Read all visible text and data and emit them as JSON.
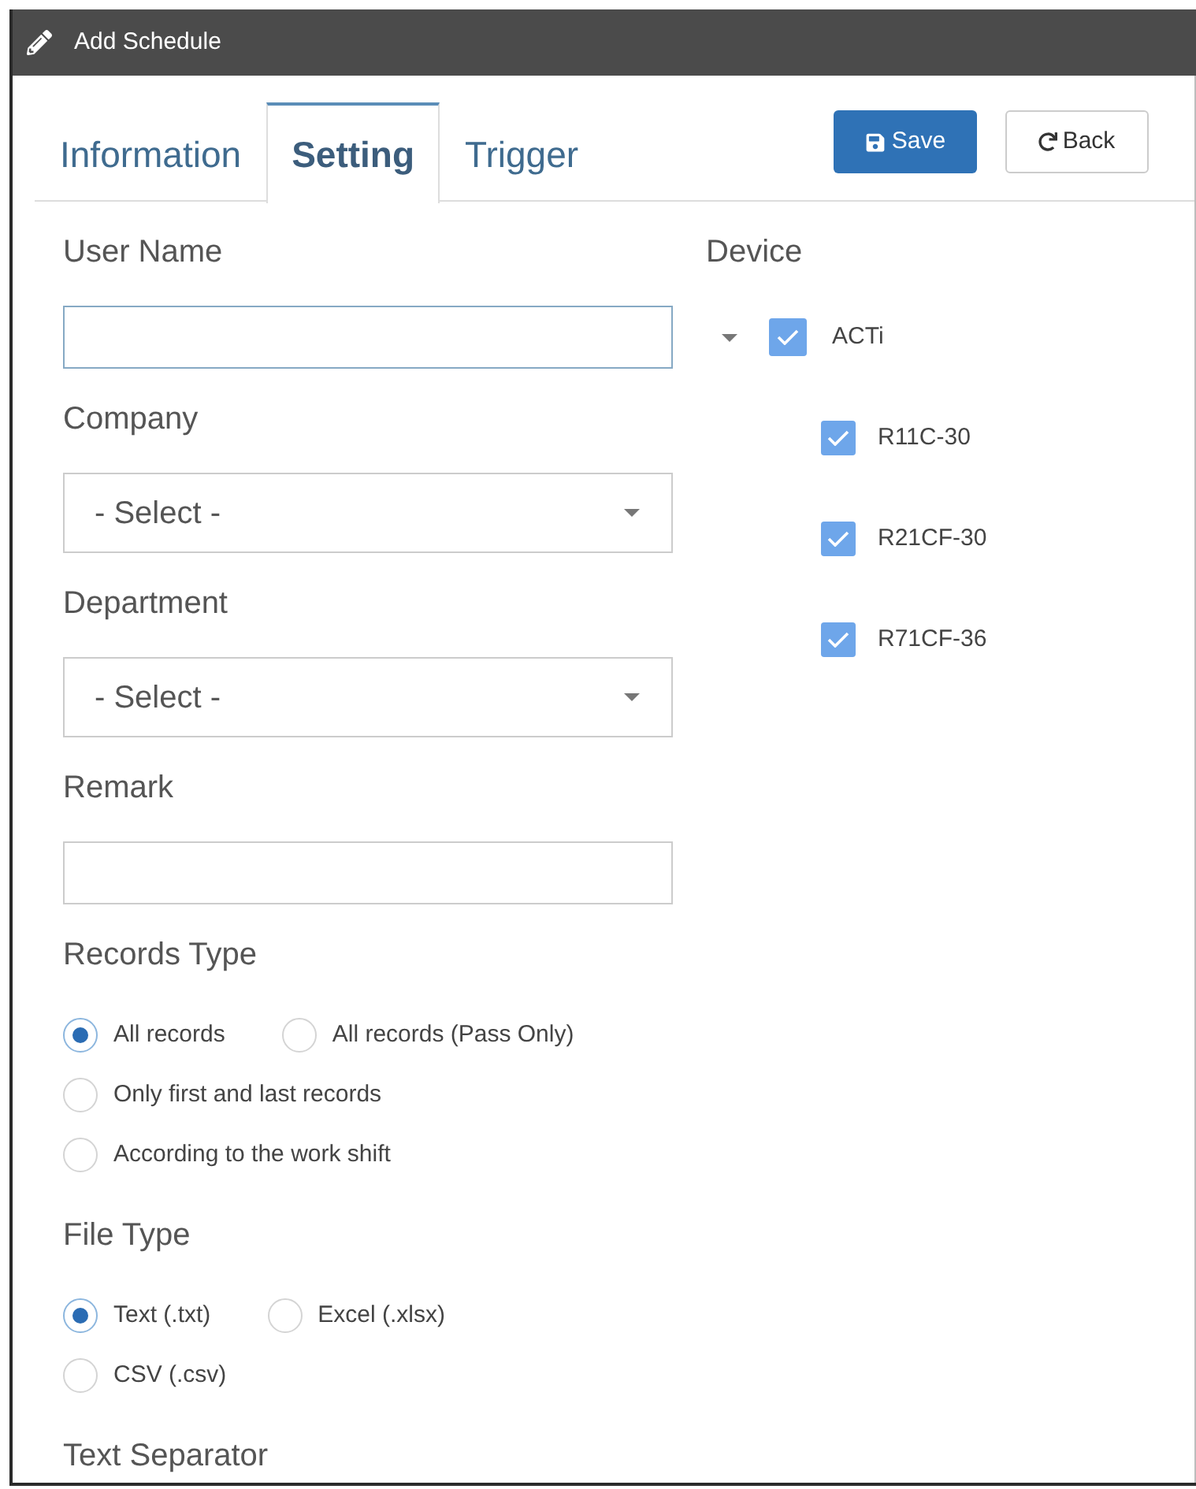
{
  "window": {
    "title": "Add Schedule"
  },
  "tabs": [
    {
      "label": "Information",
      "selected": false
    },
    {
      "label": "Setting",
      "selected": true
    },
    {
      "label": "Trigger",
      "selected": false
    }
  ],
  "actions": [
    {
      "kind": "save",
      "label": "Save"
    },
    {
      "kind": "back",
      "label": "Back"
    }
  ],
  "fields": [
    {
      "kind": "input",
      "label": "User Name",
      "focused": true
    },
    {
      "kind": "select",
      "label": "Company",
      "value": "- Select -"
    },
    {
      "kind": "select",
      "label": "Department",
      "value": "- Select -"
    },
    {
      "kind": "input",
      "label": "Remark",
      "focused": false
    },
    {
      "kind": "radios",
      "label": "Records Type",
      "options": [
        {
          "label": "All records",
          "selected": true
        },
        {
          "label": "All records (Pass Only)",
          "selected": false
        },
        {
          "label": "Only first and last records",
          "selected": false
        },
        {
          "label": "According to the work shift",
          "selected": false
        }
      ]
    },
    {
      "kind": "radios",
      "label": "File Type",
      "options": [
        {
          "label": "Text (.txt)",
          "selected": true
        },
        {
          "label": "Excel (.xlsx)",
          "selected": false
        },
        {
          "label": "CSV (.csv)",
          "selected": false
        }
      ]
    },
    {
      "kind": "heading",
      "label": "Text Separator"
    }
  ],
  "device": {
    "label": "Device",
    "tree": [
      {
        "label": "ACTi",
        "checked": true,
        "expanded": true,
        "children": [
          {
            "label": "R11C-30",
            "checked": true
          },
          {
            "label": "R21CF-30",
            "checked": true
          },
          {
            "label": "R71CF-36",
            "checked": true
          }
        ]
      }
    ]
  }
}
